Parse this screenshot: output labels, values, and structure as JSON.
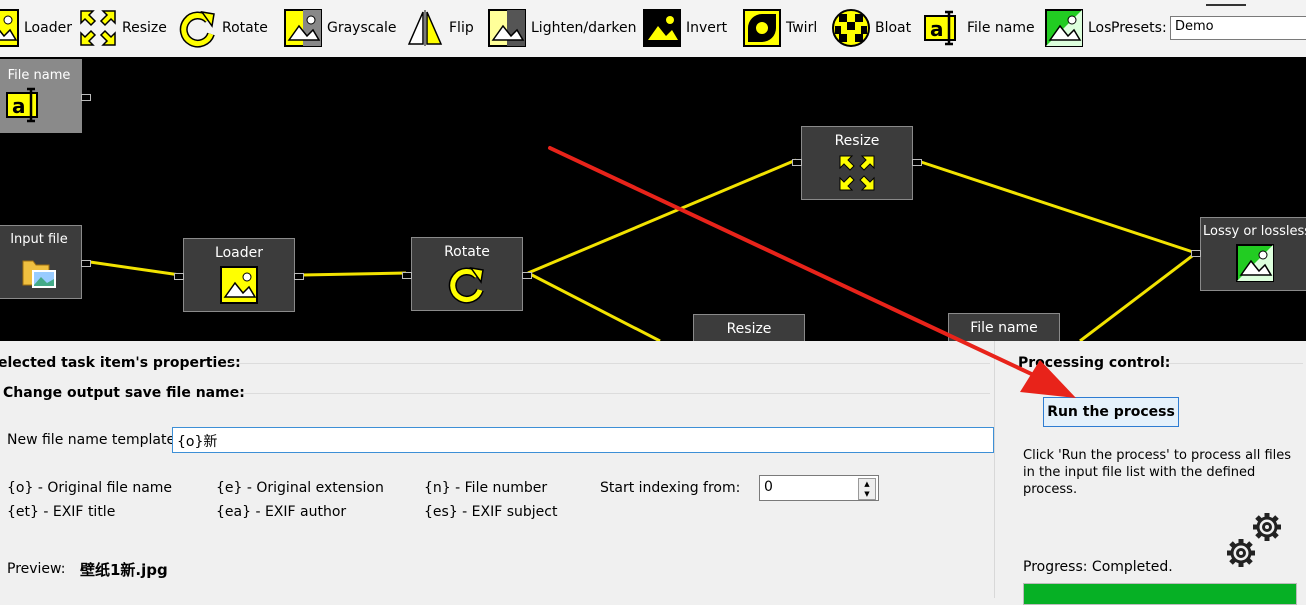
{
  "toolbar": {
    "items": [
      {
        "label": "Loader"
      },
      {
        "label": "Resize"
      },
      {
        "label": "Rotate"
      },
      {
        "label": "Grayscale"
      },
      {
        "label": "Flip"
      },
      {
        "label": "Lighten/darken"
      },
      {
        "label": "Invert"
      },
      {
        "label": "Twirl"
      },
      {
        "label": "Bloat"
      },
      {
        "label": "File name"
      },
      {
        "label": "Los"
      }
    ],
    "presets_label": "Presets:",
    "presets_value": "Demo"
  },
  "canvas": {
    "nodes": [
      {
        "label": "File name"
      },
      {
        "label": "Input file"
      },
      {
        "label": "Loader"
      },
      {
        "label": "Rotate"
      },
      {
        "label": "Resize"
      },
      {
        "label": "Lossy or lossless"
      },
      {
        "label": "Resize"
      },
      {
        "label": "File name"
      }
    ]
  },
  "properties": {
    "header": "elected task item's properties:",
    "subheader": "Change output save file name:",
    "name_template_label": "New file name template:",
    "name_template_value": "{o}新",
    "tokens": [
      {
        "text": "{o} - Original file name"
      },
      {
        "text": "{e} - Original extension"
      },
      {
        "text": "{n} - File number"
      },
      {
        "text": "{et} - EXIF title"
      },
      {
        "text": "{ea} - EXIF author"
      },
      {
        "text": "{es} - EXIF subject"
      }
    ],
    "start_index_label": "Start indexing from:",
    "start_index_value": "0",
    "preview_label": "Preview:",
    "preview_value": "壁纸1新.jpg"
  },
  "processing": {
    "header": "Processing control:",
    "run_button": "Run the process",
    "description": "Click 'Run the process' to process all files in the input file list with the defined process.",
    "progress_label": "Progress:  Completed.",
    "progress_fraction": 1.0
  },
  "colors": {
    "canvas_bg": "#000000",
    "node_bg": "#3c3c3c",
    "wire": "#f2e300",
    "icon_yellow": "#ffff00",
    "annotation_arrow": "#e8231a",
    "progress": "#06b025"
  }
}
